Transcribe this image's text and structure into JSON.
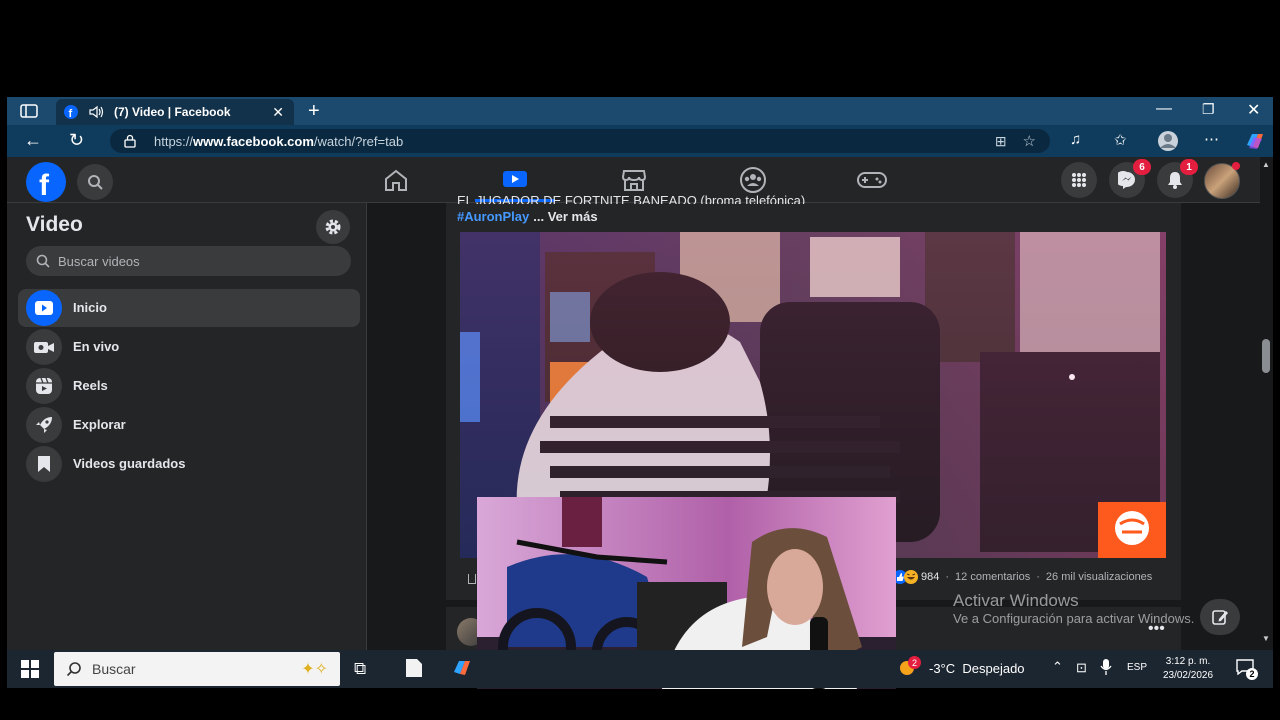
{
  "browser": {
    "tab_title": "(7) Video | Facebook",
    "url_prefix": "https://",
    "url_host": "www.facebook.com",
    "url_path": "/watch/?ref=tab"
  },
  "fb": {
    "badges": {
      "messenger": "6",
      "notifications": "1"
    }
  },
  "sidebar": {
    "title": "Video",
    "search_placeholder": "Buscar videos",
    "items": [
      {
        "label": "Inicio",
        "icon": "video-play-icon"
      },
      {
        "label": "En vivo",
        "icon": "live-camera-icon"
      },
      {
        "label": "Reels",
        "icon": "reels-icon"
      },
      {
        "label": "Explorar",
        "icon": "rocket-icon"
      },
      {
        "label": "Videos guardados",
        "icon": "bookmark-icon"
      }
    ]
  },
  "post": {
    "title_partial": "EL JUGADOR DE FORTNITE BANEADO (broma telefónica)",
    "hashtag": "#AuronPlay",
    "see_more": "... Ver más",
    "reactions": "984",
    "comments": "12 comentarios",
    "views": "26 mil visualizaciones"
  },
  "watermark": {
    "line1": "Activar Windows",
    "line2": "Ve a Configuración para activar Windows."
  },
  "taskbar": {
    "search_placeholder": "Buscar",
    "weather_badge": "2",
    "weather": "-3°C  Despejado",
    "lang": "ESP",
    "time": "3:12 p. m.",
    "date": "23/02/2026",
    "notif_count": "2"
  },
  "colors": {
    "fb_blue": "#0866ff",
    "badge_red": "#e41e3f",
    "chrome": "#1b4a6e"
  }
}
